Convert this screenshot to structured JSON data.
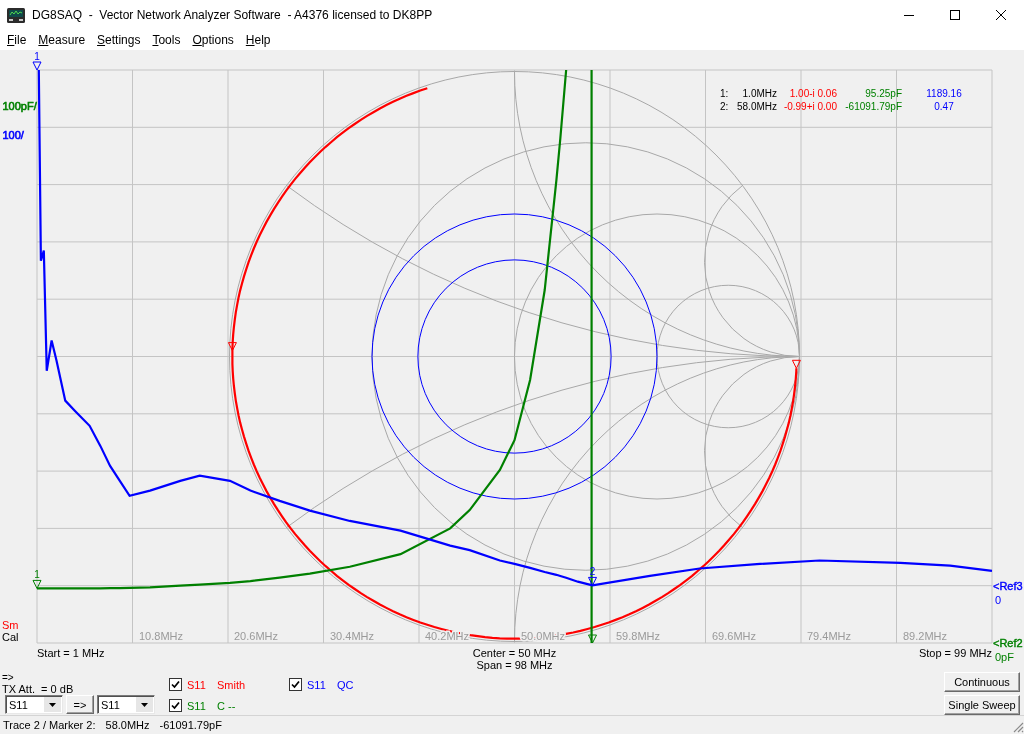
{
  "window": {
    "title": "DG8SAQ  -  Vector Network Analyzer Software  - A4376 licensed to DK8PP"
  },
  "menu": [
    "File",
    "Measure",
    "Settings",
    "Tools",
    "Options",
    "Help"
  ],
  "plot": {
    "scale_labels": [
      {
        "text": "100pF/",
        "color": "#008000"
      },
      {
        "text": "100/",
        "color": "#0000ff"
      }
    ],
    "marker_readout": [
      {
        "index": "1:",
        "frequency": "1.0MHz",
        "reflection": "1.00-i 0.06",
        "capacitance": "95.25pF",
        "q": "1189.16"
      },
      {
        "index": "2:",
        "frequency": "58.0MHz",
        "reflection": "-0.99+i 0.00",
        "capacitance": "-61091.79pF",
        "q": "0.47"
      }
    ],
    "refs": [
      {
        "label": "<Ref3",
        "value": "0",
        "color": "#0000ff"
      },
      {
        "label": "<Ref2",
        "value": "0pF",
        "color": "#008000"
      }
    ],
    "trace_flags": [
      {
        "text": "Sm",
        "kind": "trace"
      },
      {
        "text": "Cal",
        "kind": "status"
      }
    ],
    "x_axis_labels": [
      "10.8MHz",
      "20.6MHz",
      "30.4MHz",
      "40.2MHz",
      "50.0MHz",
      "59.8MHz",
      "69.6MHz",
      "79.4MHz",
      "89.2MHz"
    ],
    "start": "Start = 1 MHz",
    "center": "Center = 50 MHz",
    "span": "Span = 98 MHz",
    "stop": "Stop = 99 MHz"
  },
  "sweep_controls": {
    "arrow_label": "=>",
    "tx_attenuation": "TX Att.  = 0 dB",
    "source_combo": "S11",
    "copy_button": "=>",
    "target_combo": "S11"
  },
  "traces": [
    {
      "param": "S11",
      "name": "Smith",
      "kind": "smith",
      "color": "#ff0000",
      "checked": true
    },
    {
      "param": "S11",
      "name": "C --",
      "kind": "rect",
      "color": "#008000",
      "checked": true,
      "marker_labels": [
        "1"
      ]
    },
    {
      "param": "S11",
      "name": "QC",
      "kind": "rect",
      "color": "#0000ff",
      "checked": true,
      "marker_labels": [
        "1",
        "2"
      ]
    }
  ],
  "buttons": [
    "Continuous",
    "Single Sweep"
  ],
  "status_bar": [
    "Trace 2 / Marker 2:",
    "58.0MHz",
    "-61091.79pF"
  ]
}
